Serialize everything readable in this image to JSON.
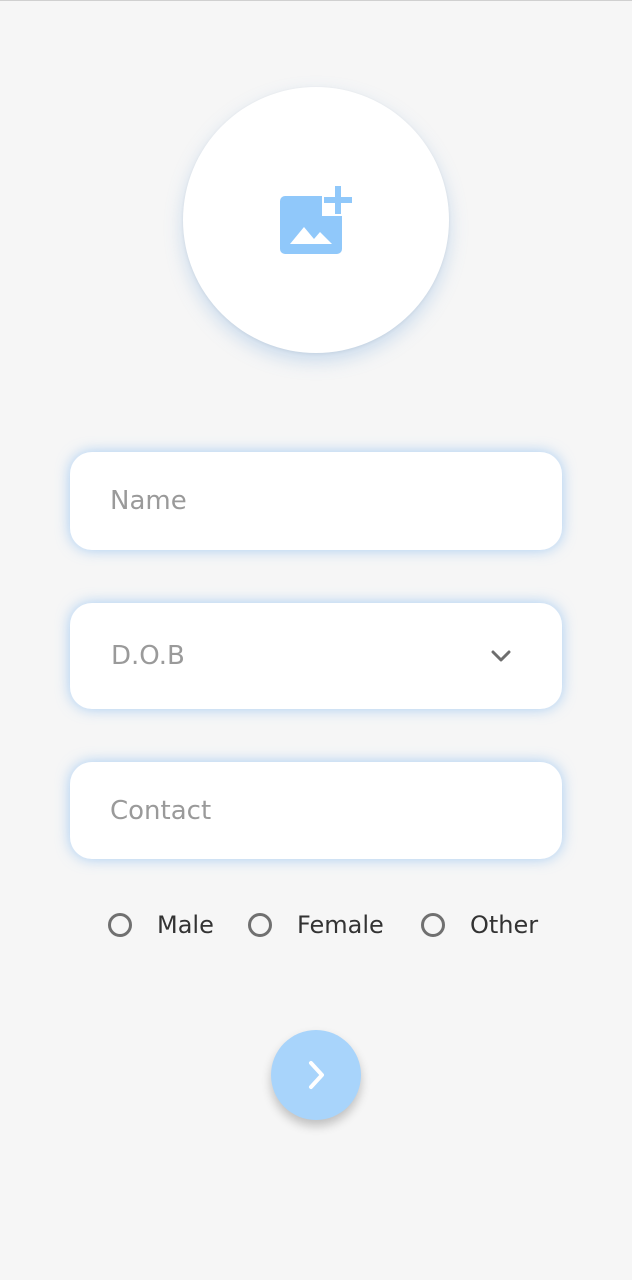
{
  "form": {
    "avatar": {
      "icon": "add-photo-icon"
    },
    "name_field": {
      "placeholder": "Name",
      "value": ""
    },
    "dob_field": {
      "placeholder": "D.O.B",
      "icon": "chevron-down-icon"
    },
    "contact_field": {
      "placeholder": "Contact",
      "value": ""
    },
    "gender": {
      "options": [
        {
          "label": "Male",
          "selected": false
        },
        {
          "label": "Female",
          "selected": false
        },
        {
          "label": "Other",
          "selected": false
        }
      ]
    },
    "next_button": {
      "icon": "chevron-right-icon"
    }
  },
  "colors": {
    "background": "#f6f6f6",
    "accent": "#a8d4fb",
    "icon_accent": "#90c8fa",
    "field_glow": "#64aaf0",
    "placeholder": "#9a9a9a",
    "label": "#333333"
  }
}
